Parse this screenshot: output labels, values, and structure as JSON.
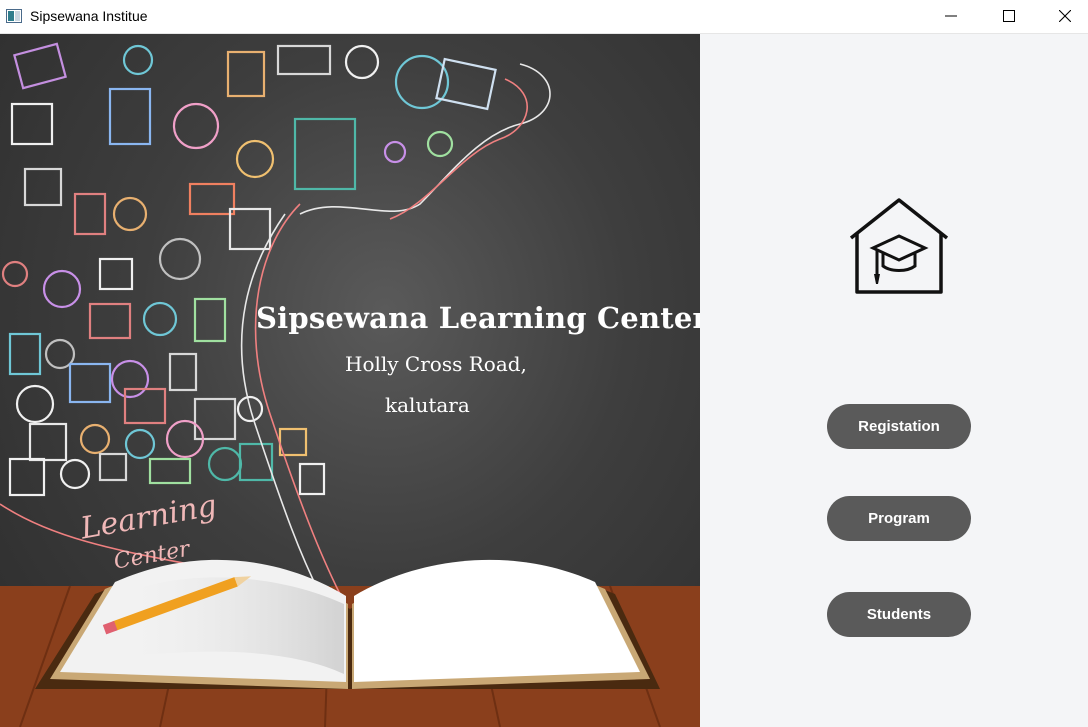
{
  "window": {
    "title": "Sipsewana Institue",
    "controls": [
      "minimize-icon",
      "maximize-icon",
      "close-icon"
    ]
  },
  "hero": {
    "title": "Sipsewana Learning Center",
    "address_line1": "Holly Cross Road,",
    "address_line2": "kalutara",
    "script_line1": "Learning",
    "script_line2": "Center"
  },
  "sidebar": {
    "logo_icon": "graduation-house-icon",
    "buttons": [
      {
        "label": "Registation"
      },
      {
        "label": "Program"
      },
      {
        "label": "Students"
      }
    ]
  },
  "colors": {
    "button_bg": "#5a5a5a",
    "panel_bg": "#f4f5f7",
    "board_bg": "#3e3e3e",
    "wood": "#8a3f1c"
  }
}
